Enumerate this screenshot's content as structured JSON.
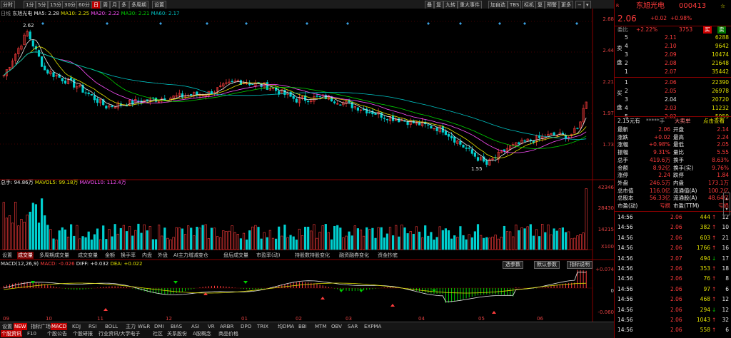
{
  "toolbar": {
    "left_tabs": [
      "分时",
      "1分",
      "5分",
      "15分",
      "30分",
      "60分",
      "日",
      "周",
      "月",
      "多",
      "多周期",
      "设置"
    ],
    "right_tabs": [
      "叠",
      "复",
      "九转",
      "重大事件",
      "加自选",
      "TBS",
      "标机",
      "复",
      "预警",
      "更多"
    ]
  },
  "chart_header": {
    "prefix": "日线",
    "name": "东旭光电",
    "ma5": "MA5: 2.28",
    "ma10": "MA10: 2.25",
    "ma20": "MA20: 2.22",
    "ma30": "MA30: 2.21",
    "ma60": "MA60: 2.17"
  },
  "price_axis": [
    "2.68",
    "2.44",
    "2.21",
    "1.97",
    "1.73"
  ],
  "price_markers": {
    "high": "2.62",
    "low": "1.55"
  },
  "volume_header": {
    "vol": "总手: 94.86万",
    "mavol5": "MAVOL5: 99.18万",
    "mavol10": "MAVOL10: 112.4万"
  },
  "volume_axis": [
    "42346",
    "28430",
    "14215",
    "X100"
  ],
  "indicator_tabs": [
    "设置",
    "成交量",
    "多周期成交量",
    "成交变量",
    "金额",
    "换手率",
    "内盘",
    "外盘",
    "AI主力增减变仓",
    "盘后成交量",
    "市盈率(动)",
    "持股数持股变化",
    "融资融券变化",
    "资金抄底"
  ],
  "macd_header": {
    "label": "MACD(12,26,9)",
    "macd": "MACD: -0.026",
    "diff": "DIFF: +0.032",
    "dea": "DEA: +0.022"
  },
  "macd_buttons": [
    "选参数",
    "默认参数",
    "指标说明"
  ],
  "macd_axis": [
    "+0.074",
    "0",
    "-0.060"
  ],
  "month_labels": [
    "09",
    "10",
    "11",
    "12",
    "01",
    "02",
    "03",
    "04",
    "05",
    "06"
  ],
  "bottom_tabs": [
    "设置",
    "NEW",
    "指标广场",
    "MACD",
    "KDJ",
    "RSI",
    "BOLL",
    "主力",
    "W&R",
    "DMI",
    "BIAS",
    "ASI",
    "VR",
    "ARBR",
    "DPO",
    "TRIX",
    "均DMA",
    "BBI",
    "MTM",
    "OBV",
    "SAR",
    "EXPMA"
  ],
  "footer_tabs": [
    "个股资讯",
    "F10",
    "个股公告",
    "个股研报",
    "行业资讯/大学电子",
    "社区",
    "关系股份",
    "A股概念",
    "商品价格"
  ],
  "stock": {
    "name": "东旭光电",
    "code": "000413",
    "price": "2.06",
    "change": "+0.02",
    "change_pct": "+0.98%",
    "weibi_label": "委比",
    "weibi": "+2.22%",
    "weicha": "3753",
    "flag": "买",
    "flag2": "卖"
  },
  "asks": [
    {
      "lvl": "5",
      "price": "2.11",
      "vol": "6288"
    },
    {
      "lvl": "4",
      "price": "2.10",
      "vol": "9642"
    },
    {
      "lvl": "3",
      "price": "2.09",
      "vol": "10474"
    },
    {
      "lvl": "2",
      "price": "2.08",
      "vol": "21648"
    },
    {
      "lvl": "1",
      "price": "2.07",
      "vol": "35442"
    }
  ],
  "bids": [
    {
      "lvl": "1",
      "price": "2.06",
      "vol": "22390"
    },
    {
      "lvl": "2",
      "price": "2.05",
      "vol": "26978"
    },
    {
      "lvl": "3",
      "price": "2.04",
      "vol": "20720"
    },
    {
      "lvl": "4",
      "price": "2.03",
      "vol": "11232"
    },
    {
      "lvl": "5",
      "price": "2.02",
      "vol": "5959"
    }
  ],
  "ask_side_label": "卖盘",
  "bid_side_label": "买盘",
  "summary_head": {
    "left": "2.15元有",
    "mid": "*****手",
    "tag": "大卖单",
    "right": "点击查看"
  },
  "stats": [
    {
      "k1": "最新",
      "v1": "2.06",
      "k2": "开盘",
      "v2": "2.14"
    },
    {
      "k1": "涨跌",
      "v1": "+0.02",
      "k2": "最高",
      "v2": "2.24"
    },
    {
      "k1": "涨幅",
      "v1": "+0.98%",
      "k2": "最低",
      "v2": "2.05"
    },
    {
      "k1": "振幅",
      "v1": "9.31%",
      "k2": "量比",
      "v2": "5.55"
    },
    {
      "k1": "总手",
      "v1": "419.6万",
      "k2": "换手",
      "v2": "8.63%"
    },
    {
      "k1": "金额",
      "v1": "8.92亿",
      "k2": "换手(实)",
      "v2": "9.76%"
    },
    {
      "k1": "涨停",
      "v1": "2.24",
      "k2": "跌停",
      "v2": "1.84"
    },
    {
      "k1": "外盘",
      "v1": "246.5万",
      "k2": "内盘",
      "v2": "173.1万"
    },
    {
      "k1": "总市值",
      "v1": "116.0亿",
      "k2": "流通值(A)",
      "v2": "100.2亿"
    },
    {
      "k1": "总股本",
      "v1": "56.33亿",
      "k2": "流通股(A)",
      "v2": "48.64亿"
    },
    {
      "k1": "市盈(动)",
      "v1": "亏损",
      "k2": "市盈(TTM)",
      "v2": "亏损"
    }
  ],
  "ticks": [
    {
      "t": "14:56",
      "p": "2.06",
      "v": "444",
      "d": "12"
    },
    {
      "t": "14:56",
      "p": "2.06",
      "v": "382",
      "d": "10"
    },
    {
      "t": "14:56",
      "p": "2.06",
      "v": "603",
      "d": "21"
    },
    {
      "t": "14:56",
      "p": "2.06",
      "v": "1766",
      "d": "16"
    },
    {
      "t": "14:56",
      "p": "2.07",
      "v": "494",
      "d": "17"
    },
    {
      "t": "14:56",
      "p": "2.06",
      "v": "353",
      "d": "18"
    },
    {
      "t": "14:56",
      "p": "2.06",
      "v": "76",
      "d": "8"
    },
    {
      "t": "14:56",
      "p": "2.06",
      "v": "97",
      "d": "6"
    },
    {
      "t": "14:56",
      "p": "2.06",
      "v": "468",
      "d": "12"
    },
    {
      "t": "14:56",
      "p": "2.06",
      "v": "294",
      "d": "12"
    },
    {
      "t": "14:56",
      "p": "2.06",
      "v": "1043",
      "d": "32"
    },
    {
      "t": "14:56",
      "p": "2.06",
      "v": "558",
      "d": "6"
    }
  ],
  "colors": {
    "up": "#ff3c3c",
    "down": "#00d000",
    "ma5": "#e8e8e8",
    "ma10": "#e0e000",
    "ma20": "#ff50ff",
    "ma30": "#00d000",
    "ma60": "#00c0c0"
  }
}
